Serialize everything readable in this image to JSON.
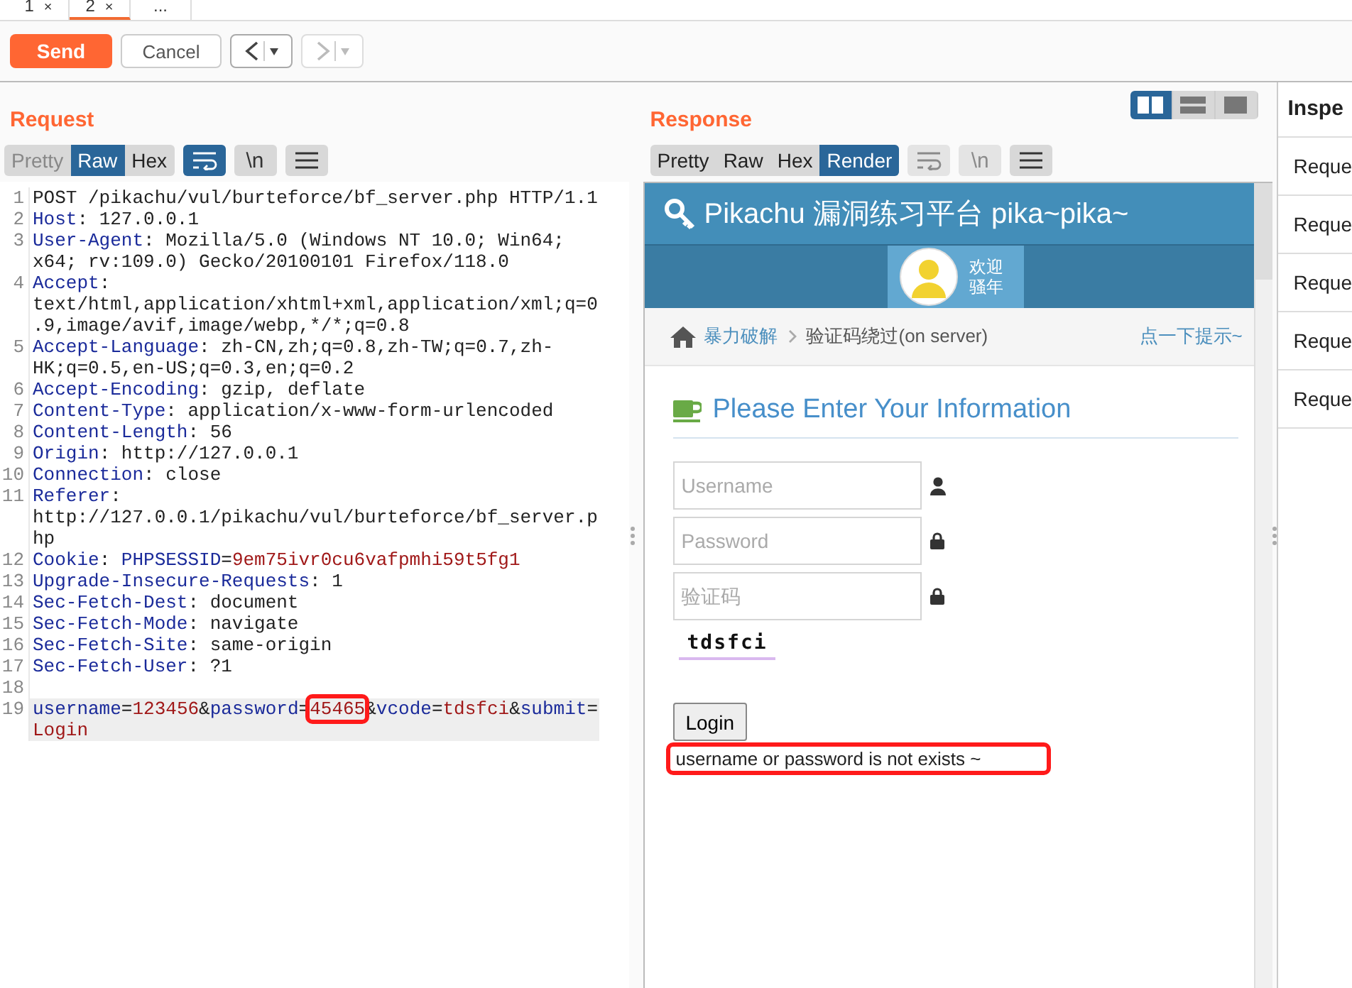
{
  "tabs": [
    {
      "label": "1",
      "close": "×",
      "selected": false
    },
    {
      "label": "2",
      "close": "×",
      "selected": true
    },
    {
      "label": "...",
      "selected": false
    }
  ],
  "toolbar": {
    "send": "Send",
    "cancel": "Cancel",
    "history": [
      {
        "kind": "back",
        "disabled": false
      },
      {
        "kind": "forward",
        "disabled": true
      }
    ]
  },
  "request": {
    "title": "Request",
    "views": [
      {
        "label": "Pretty",
        "selected": false,
        "disabled": true
      },
      {
        "label": "Raw",
        "selected": true,
        "disabled": false
      },
      {
        "label": "Hex",
        "selected": false,
        "disabled": false
      }
    ],
    "tools": [
      {
        "kind": "wrap",
        "on": true,
        "disabled": false
      },
      {
        "kind": "newline",
        "label": "\\n",
        "on": false,
        "disabled": false
      },
      {
        "kind": "menu",
        "on": false,
        "disabled": false
      }
    ],
    "lines": [
      {
        "number": "1",
        "selected": false,
        "segments": [
          {
            "kind": "plain",
            "text": "POST /pikachu/vul/burteforce/bf_server.php HTTP/1.1"
          }
        ]
      },
      {
        "number": "2",
        "selected": false,
        "segments": [
          {
            "kind": "name",
            "text": "Host"
          },
          {
            "kind": "plain",
            "text": ": 127.0.0.1"
          }
        ]
      },
      {
        "number": "3",
        "selected": false,
        "segments": [
          {
            "kind": "name",
            "text": "User-Agent"
          },
          {
            "kind": "plain",
            "text": ": Mozilla/5.0 (Windows NT 10.0; Win64; x64; rv:109.0) Gecko/20100101 Firefox/118.0"
          }
        ]
      },
      {
        "number": "4",
        "selected": false,
        "segments": [
          {
            "kind": "name",
            "text": "Accept"
          },
          {
            "kind": "plain",
            "text": ": text/html,application/xhtml+xml,application/xml;q=0.9,image/avif,image/webp,*/*;q=0.8"
          }
        ]
      },
      {
        "number": "5",
        "selected": false,
        "segments": [
          {
            "kind": "name",
            "text": "Accept-Language"
          },
          {
            "kind": "plain",
            "text": ": zh-CN,zh;q=0.8,zh-TW;q=0.7,zh-HK;q=0.5,en-US;q=0.3,en;q=0.2"
          }
        ]
      },
      {
        "number": "6",
        "selected": false,
        "segments": [
          {
            "kind": "name",
            "text": "Accept-Encoding"
          },
          {
            "kind": "plain",
            "text": ": gzip, deflate"
          }
        ]
      },
      {
        "number": "7",
        "selected": false,
        "segments": [
          {
            "kind": "name",
            "text": "Content-Type"
          },
          {
            "kind": "plain",
            "text": ": application/x-www-form-urlencoded"
          }
        ]
      },
      {
        "number": "8",
        "selected": false,
        "segments": [
          {
            "kind": "name",
            "text": "Content-Length"
          },
          {
            "kind": "plain",
            "text": ": 56"
          }
        ]
      },
      {
        "number": "9",
        "selected": false,
        "segments": [
          {
            "kind": "name",
            "text": "Origin"
          },
          {
            "kind": "plain",
            "text": ": http://127.0.0.1"
          }
        ]
      },
      {
        "number": "10",
        "selected": false,
        "segments": [
          {
            "kind": "name",
            "text": "Connection"
          },
          {
            "kind": "plain",
            "text": ": close"
          }
        ]
      },
      {
        "number": "11",
        "selected": false,
        "segments": [
          {
            "kind": "name",
            "text": "Referer"
          },
          {
            "kind": "plain",
            "text": ": http://127.0.0.1/pikachu/vul/burteforce/bf_server.php"
          }
        ]
      },
      {
        "number": "12",
        "selected": false,
        "segments": [
          {
            "kind": "name",
            "text": "Cookie"
          },
          {
            "kind": "plain",
            "text": ": "
          },
          {
            "kind": "name",
            "text": "PHPSESSID"
          },
          {
            "kind": "plain",
            "text": "="
          },
          {
            "kind": "value",
            "text": "9em75ivr0cu6vafpmhi59t5fg1"
          }
        ]
      },
      {
        "number": "13",
        "selected": false,
        "segments": [
          {
            "kind": "name",
            "text": "Upgrade-Insecure-Requests"
          },
          {
            "kind": "plain",
            "text": ": 1"
          }
        ]
      },
      {
        "number": "14",
        "selected": false,
        "segments": [
          {
            "kind": "name",
            "text": "Sec-Fetch-Dest"
          },
          {
            "kind": "plain",
            "text": ": document"
          }
        ]
      },
      {
        "number": "15",
        "selected": false,
        "segments": [
          {
            "kind": "name",
            "text": "Sec-Fetch-Mode"
          },
          {
            "kind": "plain",
            "text": ": navigate"
          }
        ]
      },
      {
        "number": "16",
        "selected": false,
        "segments": [
          {
            "kind": "name",
            "text": "Sec-Fetch-Site"
          },
          {
            "kind": "plain",
            "text": ": same-origin"
          }
        ]
      },
      {
        "number": "17",
        "selected": false,
        "segments": [
          {
            "kind": "name",
            "text": "Sec-Fetch-User"
          },
          {
            "kind": "plain",
            "text": ": ?1"
          }
        ]
      },
      {
        "number": "18",
        "selected": false
      },
      {
        "number": "19",
        "selected": true,
        "segments": [
          {
            "kind": "name",
            "text": "username"
          },
          {
            "kind": "plain",
            "text": "="
          },
          {
            "kind": "value",
            "text": "123456"
          },
          {
            "kind": "plain",
            "text": "&"
          },
          {
            "kind": "name",
            "text": "password"
          },
          {
            "kind": "plain",
            "text": "="
          },
          {
            "kind": "value",
            "text": "45465",
            "boxed": true
          },
          {
            "kind": "plain",
            "text": "&"
          },
          {
            "kind": "name",
            "text": "vcode"
          },
          {
            "kind": "plain",
            "text": "="
          },
          {
            "kind": "value",
            "text": "tdsfci"
          },
          {
            "kind": "plain",
            "text": "&"
          },
          {
            "kind": "name",
            "text": "submit"
          },
          {
            "kind": "plain",
            "text": "="
          },
          {
            "kind": "value",
            "text": "Login"
          }
        ]
      }
    ]
  },
  "response": {
    "title": "Response",
    "layouts": [
      {
        "kind": "columns",
        "selected": true
      },
      {
        "kind": "rows",
        "selected": false
      },
      {
        "kind": "single",
        "selected": false
      }
    ],
    "views": [
      {
        "label": "Pretty",
        "selected": false,
        "disabled": false
      },
      {
        "label": "Raw",
        "selected": false,
        "disabled": false
      },
      {
        "label": "Hex",
        "selected": false,
        "disabled": false
      },
      {
        "label": "Render",
        "selected": true,
        "disabled": false
      }
    ],
    "tools": [
      {
        "kind": "wrap",
        "disabled": true
      },
      {
        "kind": "newline",
        "label": "\\n",
        "disabled": true
      },
      {
        "kind": "menu",
        "disabled": false
      }
    ],
    "render": {
      "site_title": "Pikachu 漏洞练习平台 pika~pika~",
      "welcome": [
        "欢迎",
        "骚年"
      ],
      "breadcrumb": {
        "link": "暴力破解",
        "current": "验证码绕过(on server)",
        "hint": "点一下提示~"
      },
      "heading": "Please Enter Your Information",
      "fields": [
        {
          "placeholder": "Username",
          "kind": "user"
        },
        {
          "placeholder": "Password",
          "kind": "lock"
        },
        {
          "placeholder": "验证码",
          "kind": "lock"
        }
      ],
      "captcha": "tdsfci",
      "login": "Login",
      "message": {
        "text": "username or password is not exists ~",
        "highlighted": true
      }
    }
  },
  "inspector": {
    "title": "Inspe",
    "items": [
      "Reque",
      "Reque",
      "Reque",
      "Reque",
      "Reque"
    ]
  }
}
